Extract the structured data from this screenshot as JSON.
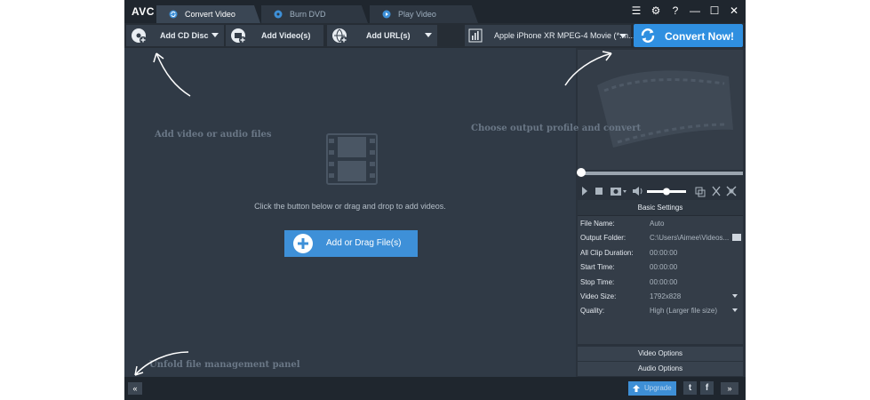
{
  "app": {
    "logo": "AVC",
    "tabs": [
      {
        "label": "Convert Video",
        "active": true,
        "icon": "convert-icon"
      },
      {
        "label": "Burn DVD",
        "active": false,
        "icon": "disc-icon"
      },
      {
        "label": "Play Video",
        "active": false,
        "icon": "play-icon"
      }
    ],
    "window_buttons": {
      "menu": "☰",
      "settings": "⚙",
      "help": "?",
      "minimize": "—",
      "maximize": "☐",
      "close": "✕"
    }
  },
  "toolbar": {
    "add_cd_label": "Add CD Disc",
    "add_video_label": "Add Video(s)",
    "add_url_label": "Add URL(s)",
    "profile_value": "Apple iPhone XR MPEG-4 Movie (*.m...",
    "convert_label": "Convert Now!"
  },
  "main": {
    "hint_add": "Add video or audio files",
    "hint_profile": "Choose output profile and convert",
    "instruction": "Click the button below or drag and drop to add videos.",
    "add_drag_label": "Add or Drag File(s)",
    "hint_unfold": "Unfold file management panel"
  },
  "settings": {
    "title": "Basic Settings",
    "rows": [
      {
        "key": "File Name:",
        "value": "Auto"
      },
      {
        "key": "Output Folder:",
        "value": "C:\\Users\\Aimee\\Videos..."
      },
      {
        "key": "All Clip Duration:",
        "value": "00:00:00"
      },
      {
        "key": "Start Time:",
        "value": "00:00:00"
      },
      {
        "key": "Stop Time:",
        "value": "00:00:00"
      },
      {
        "key": "Video Size:",
        "value": "1792x828"
      },
      {
        "key": "Quality:",
        "value": "High (Larger file size)"
      }
    ],
    "video_options_label": "Video Options",
    "audio_options_label": "Audio Options"
  },
  "statusbar": {
    "collapse_label": "«",
    "upgrade_label": "Upgrade",
    "twitter_label": "t",
    "facebook_label": "f",
    "expand_label": "»"
  },
  "colors": {
    "accent": "#2f8fe0",
    "background": "#2a323c",
    "panel": "#303a46"
  }
}
